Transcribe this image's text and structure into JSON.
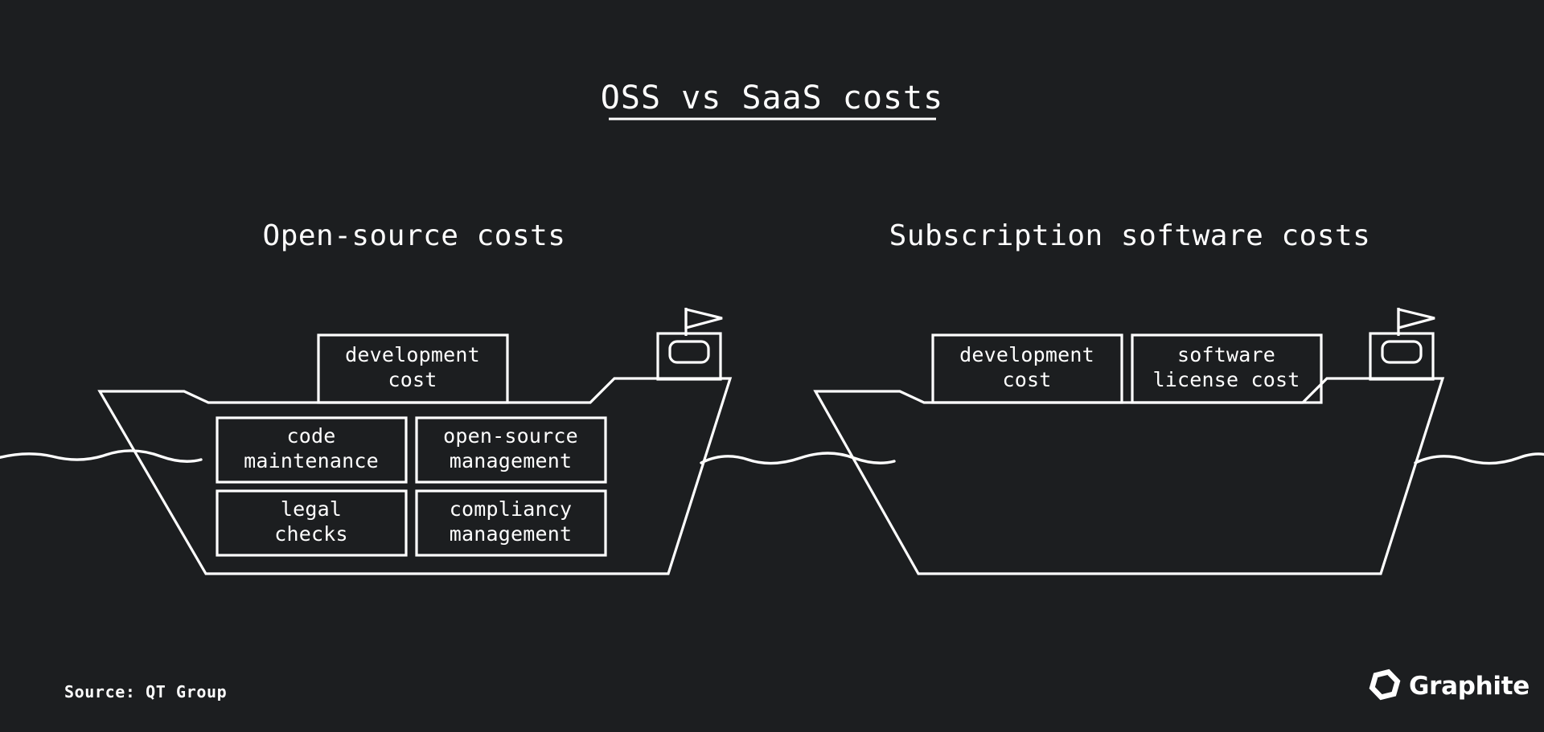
{
  "background_color": "#1c1e20",
  "line_color": "#ffffff",
  "title": {
    "text": "OSS vs SaaS costs",
    "underlined": true
  },
  "sections": [
    {
      "id": "open-source",
      "heading": "Open-source costs",
      "deck_boxes": [
        {
          "id": "oss-development-cost",
          "lines": [
            "development",
            "cost"
          ]
        }
      ],
      "hull_boxes": [
        {
          "id": "oss-code-maintenance",
          "lines": [
            "code",
            "maintenance"
          ]
        },
        {
          "id": "oss-open-source-management",
          "lines": [
            "open-source",
            "management"
          ]
        },
        {
          "id": "oss-legal-checks",
          "lines": [
            "legal",
            "checks"
          ]
        },
        {
          "id": "oss-compliancy-management",
          "lines": [
            "compliancy",
            "management"
          ]
        }
      ]
    },
    {
      "id": "subscription",
      "heading": "Subscription software costs",
      "deck_boxes": [
        {
          "id": "saas-development-cost",
          "lines": [
            "development",
            "cost"
          ]
        },
        {
          "id": "saas-software-license-cost",
          "lines": [
            "software",
            "license cost"
          ]
        }
      ],
      "hull_boxes": []
    }
  ],
  "source": {
    "label": "Source: QT Group"
  },
  "brand": {
    "name": "Graphite",
    "icon": "graphite-hexagon-logo"
  },
  "icons": {
    "flag": "pennant-flag-icon",
    "cabin": "ship-cabin-icon",
    "wave": "water-wave-icon",
    "hull": "ship-hull-icon"
  }
}
